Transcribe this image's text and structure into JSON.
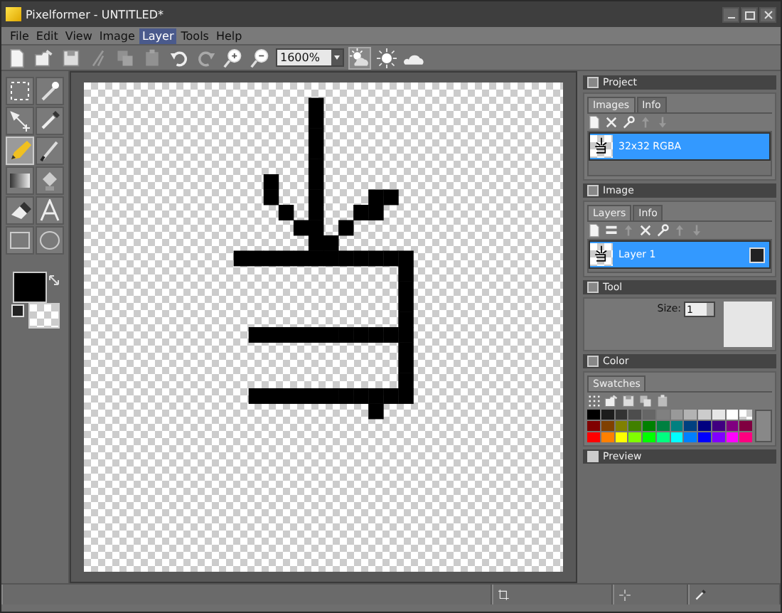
{
  "window": {
    "title": "Pixelformer - UNTITLED*"
  },
  "menu": [
    {
      "label": "File",
      "selected": false
    },
    {
      "label": "Edit",
      "selected": false
    },
    {
      "label": "View",
      "selected": false
    },
    {
      "label": "Image",
      "selected": false
    },
    {
      "label": "Layer",
      "selected": true
    },
    {
      "label": "Tools",
      "selected": false
    },
    {
      "label": "Help",
      "selected": false
    }
  ],
  "toolbar": {
    "buttons": [
      {
        "kind": "new",
        "disabled": false
      },
      {
        "kind": "open",
        "disabled": false
      },
      {
        "kind": "save",
        "disabled": false
      },
      {
        "kind": "cut",
        "disabled": true
      },
      {
        "kind": "copy",
        "disabled": true
      },
      {
        "kind": "paste",
        "disabled": true
      },
      {
        "kind": "undo",
        "disabled": false
      },
      {
        "kind": "redo",
        "disabled": true
      },
      {
        "kind": "zoom-in",
        "disabled": false
      },
      {
        "kind": "zoom-out",
        "disabled": false
      }
    ],
    "zoom": "1600%",
    "view_buttons": [
      {
        "kind": "cloud-sun",
        "selected": true
      },
      {
        "kind": "sun",
        "selected": false
      },
      {
        "kind": "cloud",
        "selected": false
      }
    ]
  },
  "tools": [
    {
      "kind": "select",
      "selected": false
    },
    {
      "kind": "wand",
      "selected": false
    },
    {
      "kind": "move",
      "selected": false
    },
    {
      "kind": "picker",
      "selected": false
    },
    {
      "kind": "pencil",
      "selected": true
    },
    {
      "kind": "brush",
      "selected": false
    },
    {
      "kind": "gradient",
      "selected": false
    },
    {
      "kind": "fill",
      "selected": false
    },
    {
      "kind": "eraser",
      "selected": false
    },
    {
      "kind": "text",
      "selected": false
    },
    {
      "kind": "rect",
      "selected": false
    },
    {
      "kind": "ellipse",
      "selected": false
    }
  ],
  "colors": {
    "primary": {
      "color": "#000000"
    },
    "secondary": {
      "kind": "transparent"
    }
  },
  "panels": {
    "project": {
      "title": "Project",
      "tabs": [
        {
          "label": "Images",
          "selected": true
        },
        {
          "label": "Info",
          "selected": false
        }
      ],
      "buttons": [
        {
          "kind": "new",
          "disabled": false
        },
        {
          "kind": "delete",
          "disabled": false
        },
        {
          "kind": "wrench",
          "disabled": false
        },
        {
          "kind": "up",
          "disabled": true
        },
        {
          "kind": "down",
          "disabled": true
        }
      ],
      "items": [
        {
          "label": "32x32 RGBA",
          "selected": true
        }
      ]
    },
    "image": {
      "title": "Image",
      "tabs": [
        {
          "label": "Layers",
          "selected": true
        },
        {
          "label": "Info",
          "selected": false
        }
      ],
      "buttons": [
        {
          "kind": "new",
          "disabled": false
        },
        {
          "kind": "layers",
          "disabled": false
        },
        {
          "kind": "up",
          "disabled": true
        },
        {
          "kind": "delete",
          "disabled": false
        },
        {
          "kind": "wrench",
          "disabled": false
        },
        {
          "kind": "up",
          "disabled": true
        },
        {
          "kind": "down",
          "disabled": true
        }
      ],
      "items": [
        {
          "label": "Layer 1",
          "selected": true
        }
      ]
    },
    "tool": {
      "title": "Tool",
      "size_label": "Size:",
      "size": "1"
    },
    "color": {
      "title": "Color",
      "tabs": [
        {
          "label": "Swatches",
          "selected": true
        }
      ],
      "buttons": [
        {
          "kind": "grid",
          "disabled": false
        },
        {
          "kind": "open",
          "disabled": false
        },
        {
          "kind": "save",
          "disabled": false
        },
        {
          "kind": "copy",
          "disabled": false
        },
        {
          "kind": "paste",
          "disabled": false
        }
      ],
      "swatches": [
        {
          "kind": "color",
          "color": "#000000"
        },
        {
          "kind": "color",
          "color": "#1c1c1c"
        },
        {
          "kind": "color",
          "color": "#333333"
        },
        {
          "kind": "color",
          "color": "#4d4d4d"
        },
        {
          "kind": "color",
          "color": "#666666"
        },
        {
          "kind": "color",
          "color": "#808080"
        },
        {
          "kind": "color",
          "color": "#999999"
        },
        {
          "kind": "color",
          "color": "#b3b3b3"
        },
        {
          "kind": "color",
          "color": "#cccccc"
        },
        {
          "kind": "color",
          "color": "#e6e6e6"
        },
        {
          "kind": "color",
          "color": "#ffffff"
        },
        {
          "kind": "transparent"
        },
        {
          "kind": "color",
          "color": "#800000"
        },
        {
          "kind": "color",
          "color": "#804000"
        },
        {
          "kind": "color",
          "color": "#808000"
        },
        {
          "kind": "color",
          "color": "#408000"
        },
        {
          "kind": "color",
          "color": "#008000"
        },
        {
          "kind": "color",
          "color": "#008040"
        },
        {
          "kind": "color",
          "color": "#008080"
        },
        {
          "kind": "color",
          "color": "#004080"
        },
        {
          "kind": "color",
          "color": "#000080"
        },
        {
          "kind": "color",
          "color": "#400080"
        },
        {
          "kind": "color",
          "color": "#800080"
        },
        {
          "kind": "color",
          "color": "#800040"
        },
        {
          "kind": "color",
          "color": "#ff0000"
        },
        {
          "kind": "color",
          "color": "#ff8000"
        },
        {
          "kind": "color",
          "color": "#ffff00"
        },
        {
          "kind": "color",
          "color": "#80ff00"
        },
        {
          "kind": "color",
          "color": "#00ff00"
        },
        {
          "kind": "color",
          "color": "#00ff80"
        },
        {
          "kind": "color",
          "color": "#00ffff"
        },
        {
          "kind": "color",
          "color": "#0080ff"
        },
        {
          "kind": "color",
          "color": "#0000ff"
        },
        {
          "kind": "color",
          "color": "#8000ff"
        },
        {
          "kind": "color",
          "color": "#ff00ff"
        },
        {
          "kind": "color",
          "color": "#ff0080"
        }
      ]
    },
    "preview": {
      "title": "Preview",
      "expanded": false
    }
  },
  "status_bar": [
    {
      "kind": "selection"
    },
    {
      "kind": "cursor"
    },
    {
      "kind": "picker"
    }
  ]
}
